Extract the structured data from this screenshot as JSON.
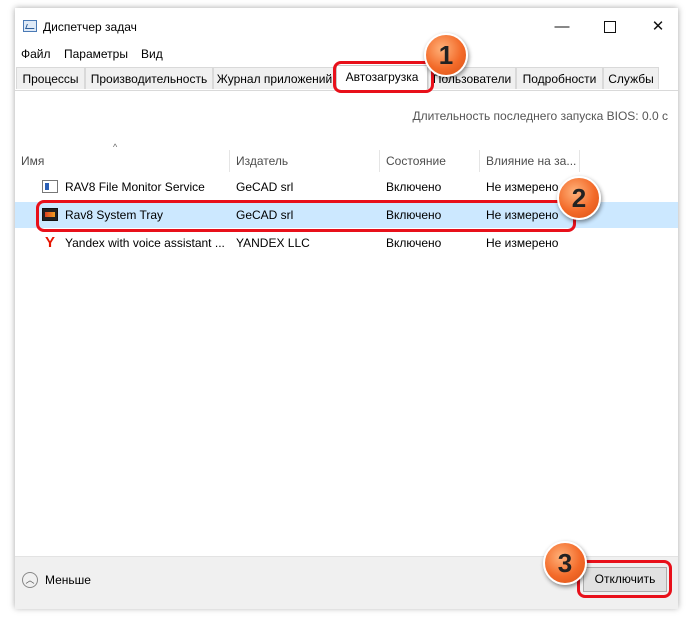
{
  "window": {
    "title": "Диспетчер задач",
    "controls": {
      "minimize": "—",
      "close": "✕"
    }
  },
  "menu": [
    "Файл",
    "Параметры",
    "Вид"
  ],
  "tabs": [
    {
      "label": "Процессы",
      "active": false
    },
    {
      "label": "Производительность",
      "active": false
    },
    {
      "label": "Журнал приложений",
      "active": false
    },
    {
      "label": "Автозагрузка",
      "active": true
    },
    {
      "label": "Пользователи",
      "active": false
    },
    {
      "label": "Подробности",
      "active": false
    },
    {
      "label": "Службы",
      "active": false
    }
  ],
  "bios_text": "Длительность последнего запуска BIOS: 0.0 с",
  "sort_indicator": "^",
  "columns": [
    "Имя",
    "Издатель",
    "Состояние",
    "Влияние на за..."
  ],
  "rows": [
    {
      "name": "RAV8 File Monitor Service",
      "publisher": "GeCAD srl",
      "status": "Включено",
      "impact": "Не измерено",
      "icon": "monitor-app-icon"
    },
    {
      "name": "Rav8 System Tray",
      "publisher": "GeCAD srl",
      "status": "Включено",
      "impact": "Не измерено",
      "icon": "tray-app-icon",
      "selected": true
    },
    {
      "name": "Yandex with voice assistant ...",
      "publisher": "YANDEX LLC",
      "status": "Включено",
      "impact": "Не измерено",
      "icon": "yandex-icon"
    }
  ],
  "footer": {
    "less_label": "Меньше",
    "disable_button": "Отключить"
  },
  "annotations": [
    "1",
    "2",
    "3"
  ],
  "colors": {
    "selected_row": "#cce8ff",
    "callout": "#e8101a",
    "badge": "#f36b2a"
  }
}
